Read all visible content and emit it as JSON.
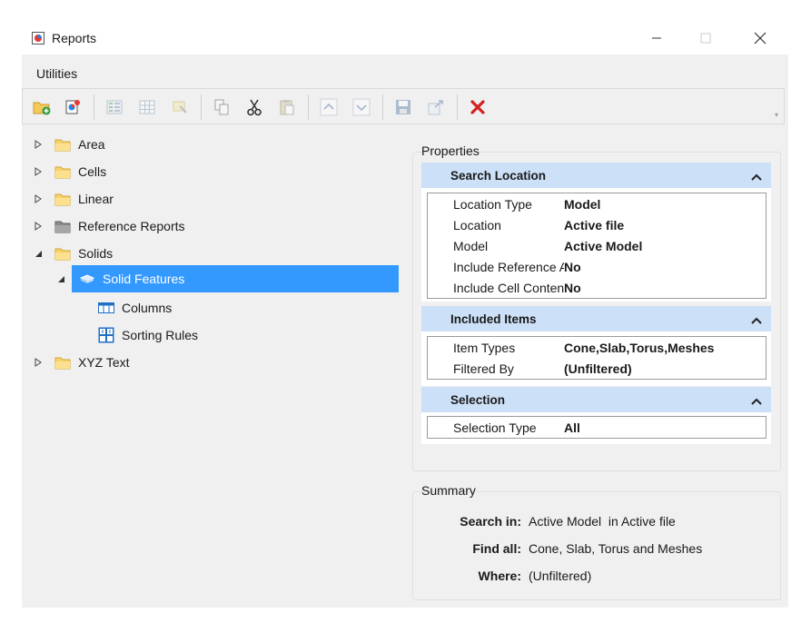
{
  "window": {
    "title": "Reports"
  },
  "menu": {
    "utilities": "Utilities"
  },
  "toolbar": {
    "items": [
      "add-folder-icon",
      "new-report-icon",
      "properties-list-icon",
      "table-icon",
      "highlight-icon",
      "copy-icon",
      "cut-icon",
      "paste-icon",
      "move-up-icon",
      "move-down-icon",
      "save-icon",
      "export-icon",
      "delete-icon"
    ]
  },
  "tree": {
    "area": "Area",
    "cells": "Cells",
    "linear": "Linear",
    "reference_reports": "Reference Reports",
    "solids": "Solids",
    "solid_features": "Solid Features",
    "columns": "Columns",
    "sorting_rules": "Sorting Rules",
    "xyz_text": "XYZ Text"
  },
  "properties": {
    "title": "Properties",
    "search_location": {
      "header": "Search Location",
      "rows": [
        {
          "k": "Location Type",
          "v": "Model"
        },
        {
          "k": "Location",
          "v": "Active file"
        },
        {
          "k": "Model",
          "v": "Active Model"
        },
        {
          "k": "Include Reference Att",
          "v": "No"
        },
        {
          "k": "Include Cell Contents",
          "v": "No"
        }
      ]
    },
    "included_items": {
      "header": "Included Items",
      "rows": [
        {
          "k": "Item Types",
          "v": "Cone,Slab,Torus,Meshes"
        },
        {
          "k": "Filtered By",
          "v": "(Unfiltered)"
        }
      ]
    },
    "selection": {
      "header": "Selection",
      "rows": [
        {
          "k": "Selection Type",
          "v": "All"
        }
      ]
    }
  },
  "summary": {
    "title": "Summary",
    "search_in_label": "Search in:",
    "search_in_value": "Active Model  in Active file",
    "find_all_label": "Find all:",
    "find_all_value": "Cone, Slab, Torus and Meshes",
    "where_label": "Where:",
    "where_value": "(Unfiltered)"
  }
}
